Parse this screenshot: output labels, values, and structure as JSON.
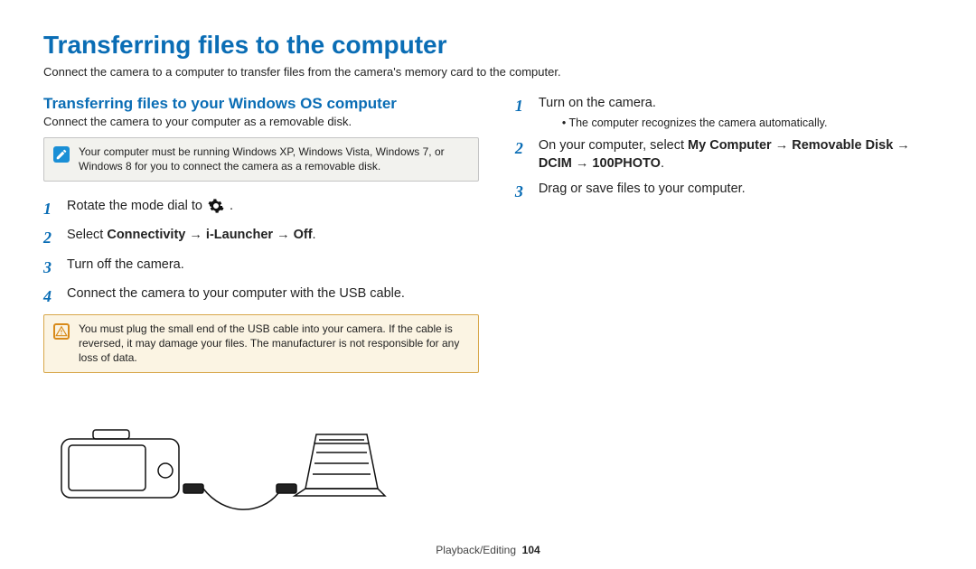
{
  "title": "Transferring files to the computer",
  "intro": "Connect the camera to a computer to transfer files from the camera's memory card to the computer.",
  "section": {
    "heading": "Transferring files to your Windows OS computer",
    "subtitle": "Connect the camera to your computer as a removable disk."
  },
  "note_info": "Your computer must be running Windows XP, Windows Vista, Windows 7, or Windows 8 for you to connect the camera as a removable disk.",
  "steps_left": {
    "s1": "Rotate the mode dial to ",
    "s1_tail": ".",
    "s2_pre": "Select ",
    "s2_bold": "Connectivity → i-Launcher → Off",
    "s2_tail": ".",
    "s3": "Turn off the camera.",
    "s4": "Connect the camera to your computer with the USB cable."
  },
  "note_warn": "You must plug the small end of the USB cable into your camera. If the cable is reversed, it may damage your files. The manufacturer is not responsible for any loss of data.",
  "steps_right": {
    "s5": "Turn on the camera.",
    "s5_sub": "The computer recognizes the camera automatically.",
    "s6_pre": "On your computer, select ",
    "s6_bold1": "My Computer → Removable Disk → DCIM → 100PHOTO",
    "s6_tail": ".",
    "s7": "Drag or save files to your computer."
  },
  "footer": {
    "section": "Playback/Editing",
    "page": "104"
  }
}
